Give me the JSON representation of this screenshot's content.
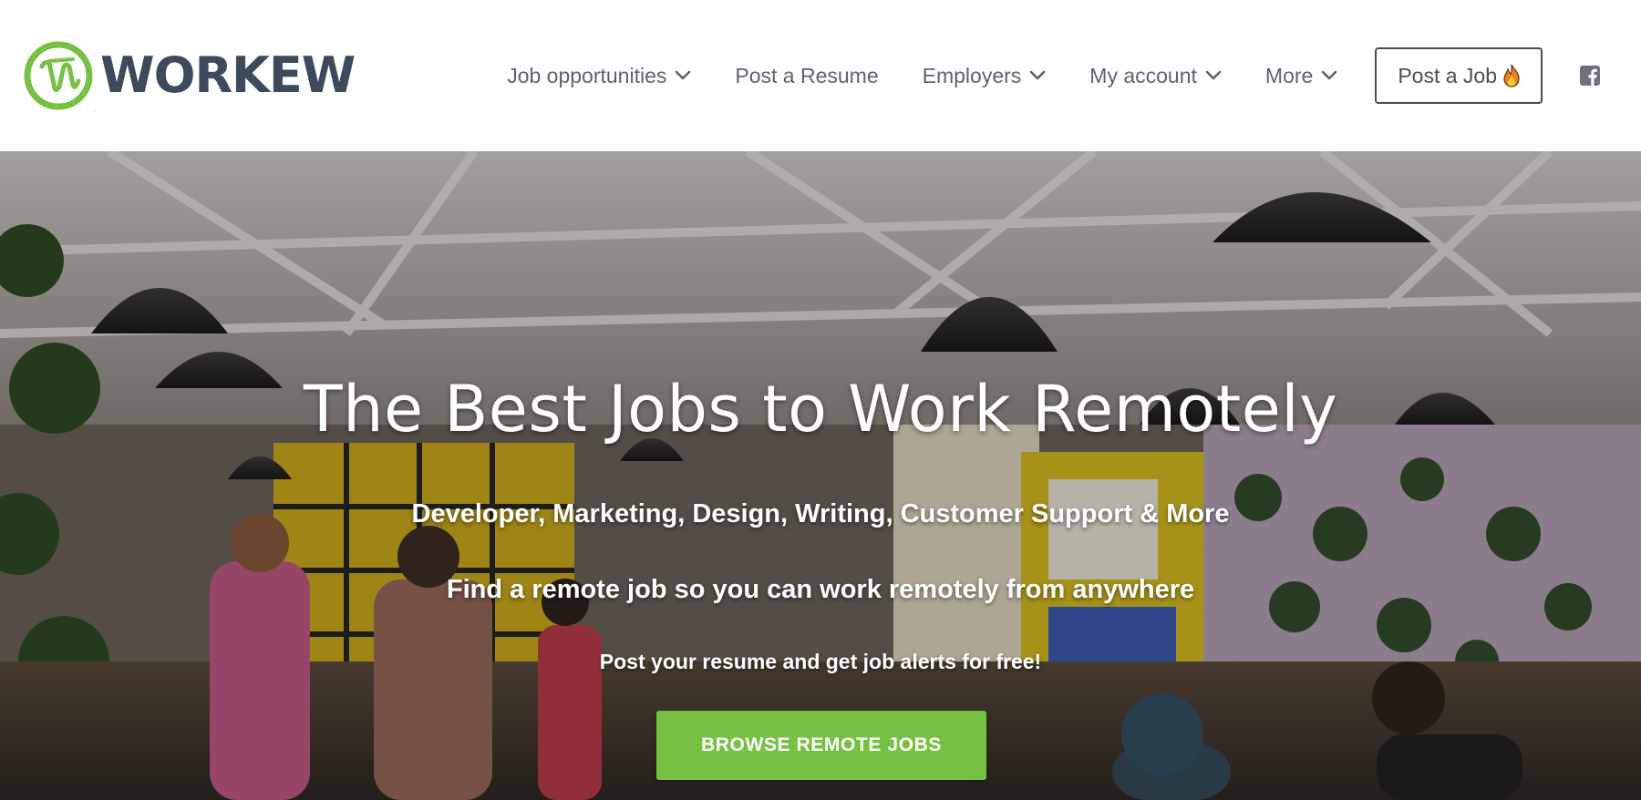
{
  "brand": {
    "name": "WORKEW",
    "accent_color": "#76c043",
    "text_color": "#3d4a5c",
    "logo_icon": "workew-logo-icon"
  },
  "nav": {
    "items": [
      {
        "label": "Job opportunities",
        "has_dropdown": true,
        "icon": "chevron-down-icon"
      },
      {
        "label": "Post a Resume",
        "has_dropdown": false
      },
      {
        "label": "Employers",
        "has_dropdown": true,
        "icon": "chevron-down-icon"
      },
      {
        "label": "My account",
        "has_dropdown": true,
        "icon": "chevron-down-icon"
      },
      {
        "label": "More",
        "has_dropdown": true,
        "icon": "chevron-down-icon"
      }
    ],
    "post_job": {
      "label": "Post a Job",
      "icon": "flame-icon"
    },
    "social": {
      "icon": "facebook-icon"
    }
  },
  "hero": {
    "title": "The Best Jobs to Work Remotely",
    "subtitle_categories": "Developer, Marketing, Design, Writing, Customer Support & More",
    "subtitle_anywhere": "Find a remote job so you can work remotely from anywhere",
    "subtitle_alerts": "Post your resume and get job alerts for free!",
    "cta_label": "BROWSE REMOTE JOBS",
    "cta_color": "#76c043",
    "background": "coworking-office-photo"
  }
}
